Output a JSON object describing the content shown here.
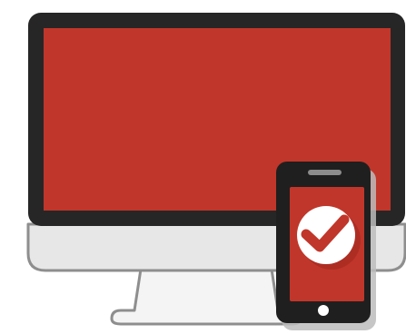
{
  "illustration": {
    "icons": {
      "monitor": "desktop-monitor-icon",
      "phone": "smartphone-icon",
      "check": "checkmark-icon"
    },
    "colors": {
      "bezel": "#262626",
      "screen": "#c1362a",
      "chin": "#e7e7e7",
      "outline": "#8e8e8e",
      "stand": "#f2f2f2",
      "phone_body": "#1f1f1f",
      "phone_screen": "#c1362a",
      "badge": "#ffffff",
      "check": "#c1362a",
      "shadow": "#b7b7b7"
    }
  }
}
